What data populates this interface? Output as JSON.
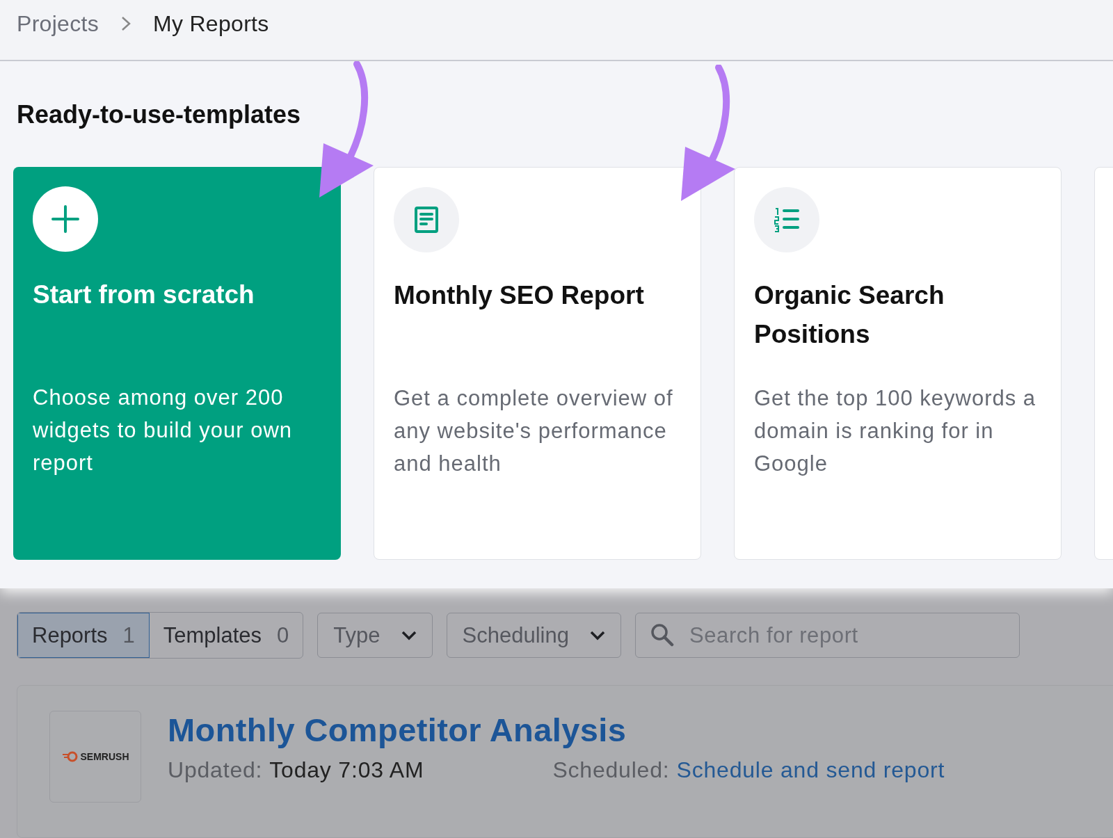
{
  "breadcrumb": [
    {
      "label": "Projects",
      "current": false
    },
    {
      "label": "My Reports",
      "current": true
    }
  ],
  "section_title": "Ready-to-use-templates",
  "cards": [
    {
      "kind": "scratch",
      "title": "Start from scratch",
      "description": "Choose among over 200 widgets to build your own report"
    },
    {
      "kind": "template",
      "title": "Monthly SEO Report",
      "description": "Get a complete overview of any website's performance and health"
    },
    {
      "kind": "template",
      "title": "Organic Search Positions",
      "description": "Get the top 100 keywords a domain is ranking for in Google"
    },
    {
      "kind": "partial"
    }
  ],
  "tabs": [
    {
      "label": "Reports",
      "count": "1",
      "selected": true
    },
    {
      "label": "Templates",
      "count": "0",
      "selected": false
    }
  ],
  "filters": [
    {
      "label": "Type"
    },
    {
      "label": "Scheduling"
    }
  ],
  "search": {
    "placeholder": "Search for report"
  },
  "report": {
    "logo": "SEMRUSH",
    "title": "Monthly Competitor Analysis",
    "updated_label": "Updated:",
    "updated_value": "Today 7:03 AM",
    "scheduled_label": "Scheduled:",
    "scheduled_link": "Schedule and send report"
  }
}
